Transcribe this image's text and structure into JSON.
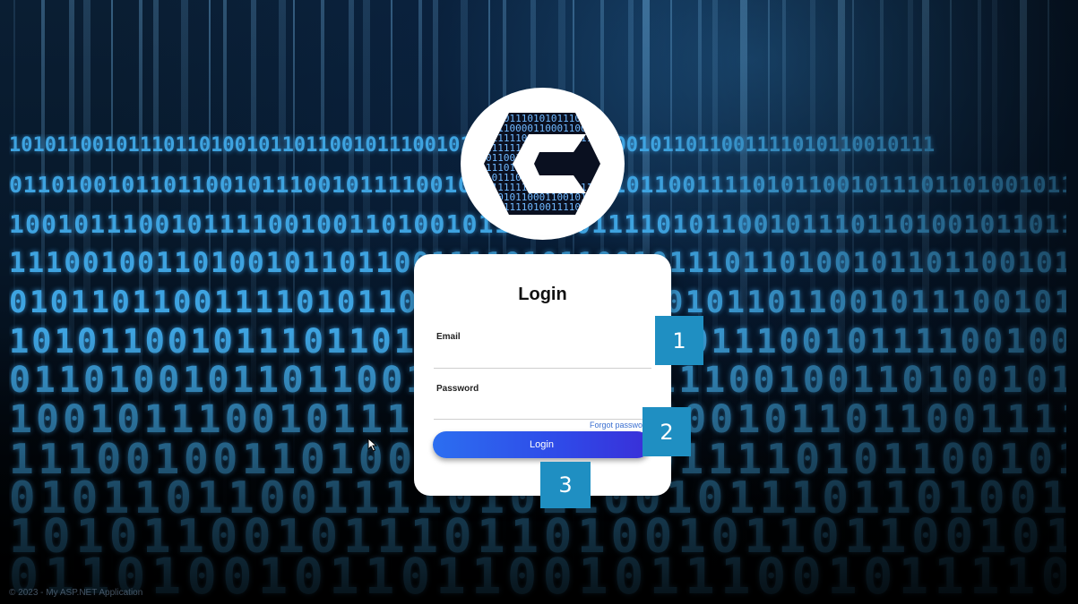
{
  "login": {
    "title": "Login",
    "email_label": "Email",
    "email_value": "",
    "password_label": "Password",
    "password_value": "",
    "forgot_link": "Forgot password?",
    "submit_label": "Login"
  },
  "callouts": [
    "1",
    "2",
    "3"
  ],
  "footer": {
    "text": "© 2023 - My ASP.NET Application"
  },
  "logo": {
    "icon": "binary-hexagon-c-logo",
    "binary_rows": [
      "10101110",
      "00110000110",
      "111111011110",
      "1111",
      "0110",
      "1110",
      "1011",
      "011111100101",
      "10010110001",
      "10011110"
    ]
  },
  "background": {
    "icon": "binary-digits-background"
  },
  "colors": {
    "accent": "#2f49e8",
    "callout": "#1f8fc2",
    "link": "#3a6fd0"
  }
}
